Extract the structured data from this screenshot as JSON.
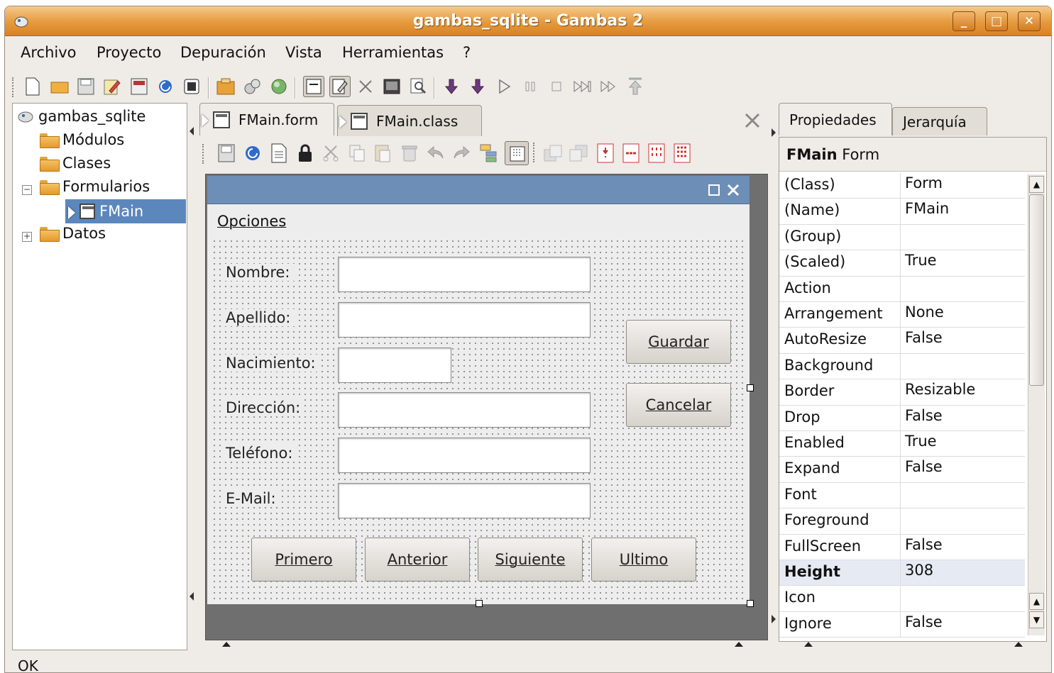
{
  "window": {
    "title": "gambas_sqlite - Gambas 2",
    "minimize": "_",
    "maximize": "□",
    "close": "✕"
  },
  "menu": [
    "Archivo",
    "Proyecto",
    "Depuración",
    "Vista",
    "Herramientas",
    "?"
  ],
  "project_tree": {
    "root": "gambas_sqlite",
    "items": [
      {
        "label": "Módulos"
      },
      {
        "label": "Clases"
      },
      {
        "label": "Formularios"
      },
      {
        "label": "FMain"
      },
      {
        "label": "Datos"
      }
    ]
  },
  "editor_tabs": [
    "FMain.form",
    "FMain.class"
  ],
  "form": {
    "menu_label": "Opciones",
    "fields": [
      "Nombre:",
      "Apellido:",
      "Nacimiento:",
      "Dirección:",
      "Teléfono:",
      "E-Mail:"
    ],
    "side_buttons": [
      "Guardar",
      "Cancelar"
    ],
    "nav_buttons": [
      "Primero",
      "Anterior",
      "Siguiente",
      "Ultimo"
    ]
  },
  "properties_panel": {
    "tabs": [
      "Propiedades",
      "Jerarquía"
    ],
    "header_name": "FMain",
    "header_type": "Form",
    "rows": [
      {
        "key": "(Class)",
        "value": "Form"
      },
      {
        "key": "(Name)",
        "value": "FMain"
      },
      {
        "key": "(Group)",
        "value": ""
      },
      {
        "key": "(Scaled)",
        "value": "True"
      },
      {
        "key": "Action",
        "value": ""
      },
      {
        "key": "Arrangement",
        "value": "None"
      },
      {
        "key": "AutoResize",
        "value": "False"
      },
      {
        "key": "Background",
        "value": ""
      },
      {
        "key": "Border",
        "value": "Resizable"
      },
      {
        "key": "Drop",
        "value": "False"
      },
      {
        "key": "Enabled",
        "value": "True"
      },
      {
        "key": "Expand",
        "value": "False"
      },
      {
        "key": "Font",
        "value": ""
      },
      {
        "key": "Foreground",
        "value": ""
      },
      {
        "key": "FullScreen",
        "value": "False"
      },
      {
        "key": "Height",
        "value": "308"
      },
      {
        "key": "Icon",
        "value": ""
      },
      {
        "key": "Ignore",
        "value": "False"
      }
    ],
    "selected_row": "Height"
  },
  "status": "OK",
  "colors": {
    "titlebar": "#e59a3d",
    "selection": "#5b87bd",
    "form_titlebar": "#6d8fb7"
  }
}
